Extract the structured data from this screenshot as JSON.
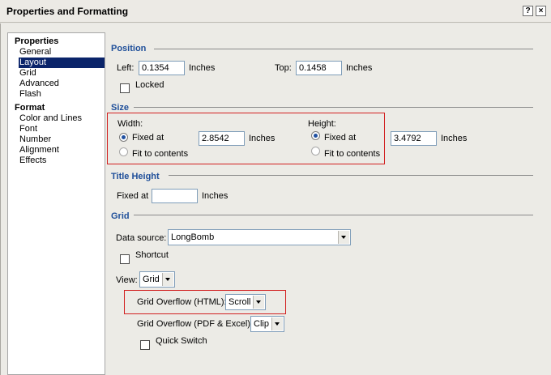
{
  "window": {
    "title": "Properties and Formatting",
    "help_label": "?",
    "close_label": "×"
  },
  "sidebar": {
    "sections": [
      {
        "label": "Properties",
        "items": [
          "General",
          "Layout",
          "Grid",
          "Advanced",
          "Flash"
        ]
      },
      {
        "label": "Format",
        "items": [
          "Color and Lines",
          "Font",
          "Number",
          "Alignment",
          "Effects"
        ]
      }
    ],
    "selected": "Layout"
  },
  "position": {
    "header": "Position",
    "left_label": "Left:",
    "left_value": "0.1354",
    "left_unit": "Inches",
    "top_label": "Top:",
    "top_value": "0.1458",
    "top_unit": "Inches",
    "locked_label": "Locked",
    "locked": false
  },
  "size": {
    "header": "Size",
    "width_label": "Width:",
    "width_fixed_label": "Fixed at",
    "width_value": "2.8542",
    "width_unit": "Inches",
    "width_fit_label": "Fit to contents",
    "height_label": "Height:",
    "height_fixed_label": "Fixed at",
    "height_value": "3.4792",
    "height_unit": "Inches",
    "height_fit_label": "Fit to contents"
  },
  "title_height": {
    "header": "Title Height",
    "fixed_label": "Fixed at",
    "value": "",
    "unit": "Inches"
  },
  "grid": {
    "header": "Grid",
    "data_source_label": "Data source:",
    "data_source_value": "LongBomb",
    "shortcut_label": "Shortcut",
    "view_label": "View:",
    "view_value": "Grid",
    "overflow_html_label": "Grid Overflow (HTML):",
    "overflow_html_value": "Scroll",
    "overflow_pdf_label": "Grid Overflow (PDF & Excel):",
    "overflow_pdf_value": "Clip",
    "quick_switch_label": "Quick Switch"
  },
  "colors": {
    "header_blue": "#1f4f9a",
    "selection_navy": "#0a246a",
    "highlight_red": "#d22020"
  }
}
